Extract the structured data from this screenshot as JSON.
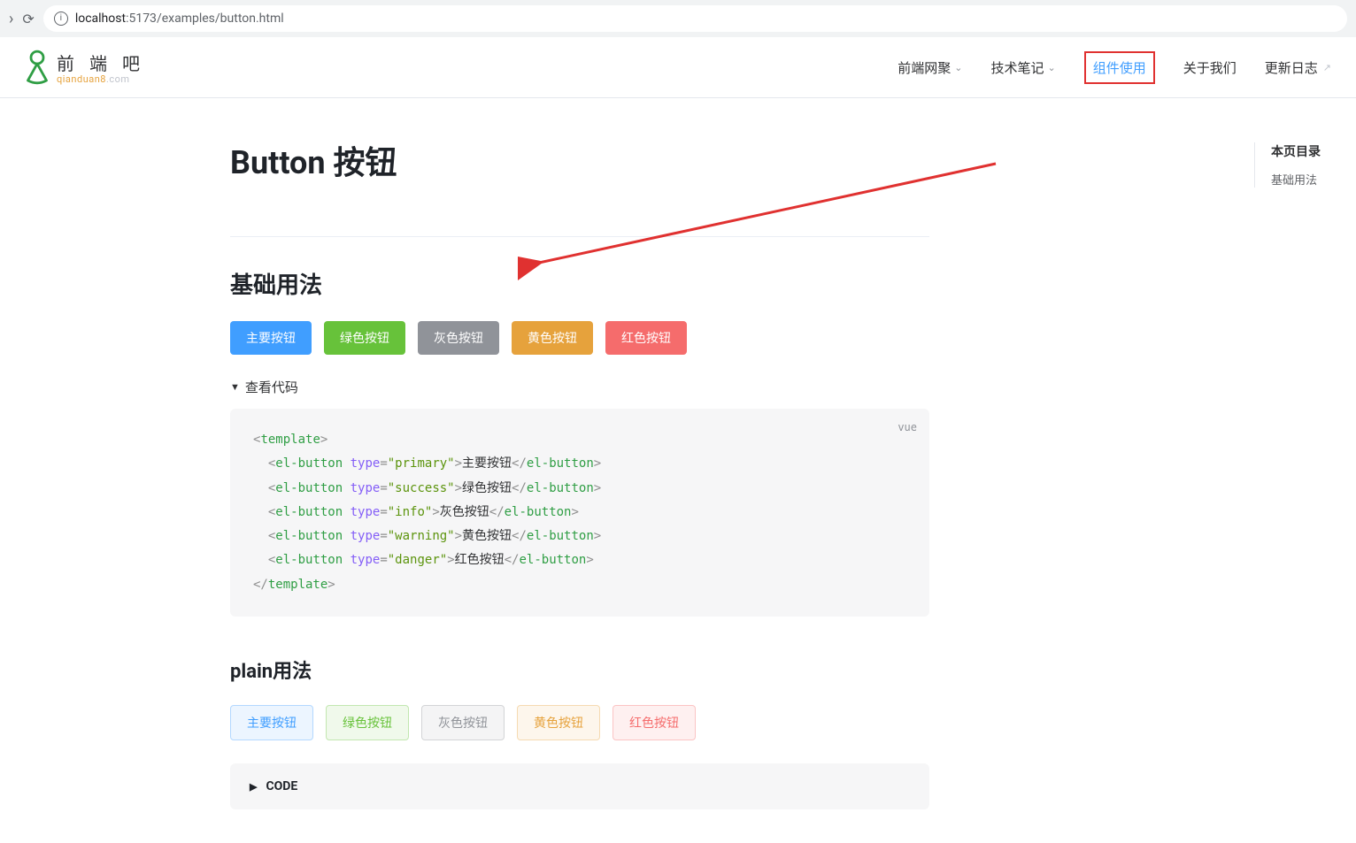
{
  "browser": {
    "url_host": "localhost",
    "url_port": ":5173",
    "url_path": "/examples/button.html"
  },
  "site": {
    "logo_cn": "前 端 吧",
    "logo_en_prefix": "qianduan8",
    "logo_en_suffix": ".com",
    "nav": [
      {
        "label": "前端网聚",
        "dropdown": true
      },
      {
        "label": "技术笔记",
        "dropdown": true
      },
      {
        "label": "组件使用",
        "active": true
      },
      {
        "label": "关于我们"
      },
      {
        "label": "更新日志",
        "external": true
      }
    ]
  },
  "toc": {
    "title": "本页目录",
    "items": [
      "基础用法"
    ]
  },
  "page_title": "Button 按钮",
  "section_basic": {
    "heading": "基础用法",
    "buttons": [
      {
        "label": "主要按钮",
        "type": "primary"
      },
      {
        "label": "绿色按钮",
        "type": "success"
      },
      {
        "label": "灰色按钮",
        "type": "info"
      },
      {
        "label": "黄色按钮",
        "type": "warning"
      },
      {
        "label": "红色按钮",
        "type": "danger"
      }
    ],
    "toggle_label": "查看代码",
    "code_lang": "vue",
    "code_lines": [
      {
        "tag": "template"
      },
      {
        "tag": "el-button",
        "attr": "type",
        "val": "primary",
        "text": "主要按钮"
      },
      {
        "tag": "el-button",
        "attr": "type",
        "val": "success",
        "text": "绿色按钮"
      },
      {
        "tag": "el-button",
        "attr": "type",
        "val": "info",
        "text": "灰色按钮"
      },
      {
        "tag": "el-button",
        "attr": "type",
        "val": "warning",
        "text": "黄色按钮"
      },
      {
        "tag": "el-button",
        "attr": "type",
        "val": "danger",
        "text": "红色按钮"
      },
      {
        "tag_close": "template"
      }
    ]
  },
  "section_plain": {
    "heading": "plain用法",
    "buttons": [
      {
        "label": "主要按钮",
        "type": "primary"
      },
      {
        "label": "绿色按钮",
        "type": "success"
      },
      {
        "label": "灰色按钮",
        "type": "info"
      },
      {
        "label": "黄色按钮",
        "type": "warning"
      },
      {
        "label": "红色按钮",
        "type": "danger"
      }
    ],
    "code_bar_label": "CODE"
  }
}
